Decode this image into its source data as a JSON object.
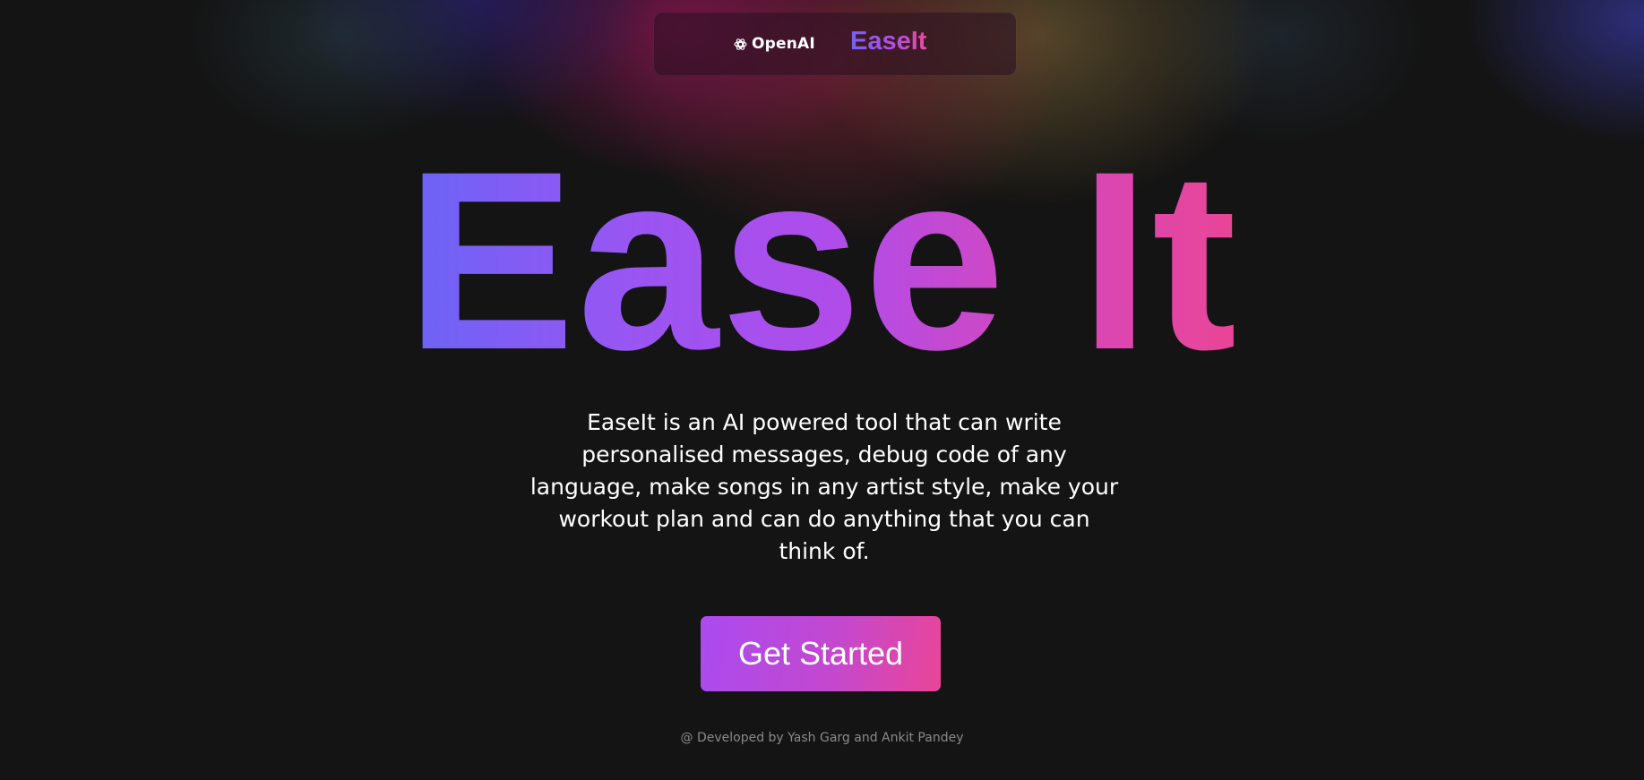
{
  "nav": {
    "openai_label": "OpenAI",
    "openai_icon": "openai-logo-icon",
    "brand": "EaseIt"
  },
  "hero": {
    "title": "Ease It",
    "description": "EaseIt is an AI powered tool that can write personalised messages, debug code of any language, make songs in any artist style, make your workout plan and can do anything that you can think of.",
    "cta_label": "Get Started"
  },
  "footer": {
    "credit": "@ Developed by Yash Garg and Ankit Pandey"
  },
  "colors": {
    "background": "#141414",
    "gradient_start": "#6a64f6",
    "gradient_mid": "#b04cea",
    "gradient_end": "#ea4596",
    "footer_text": "#8a8a8a"
  }
}
